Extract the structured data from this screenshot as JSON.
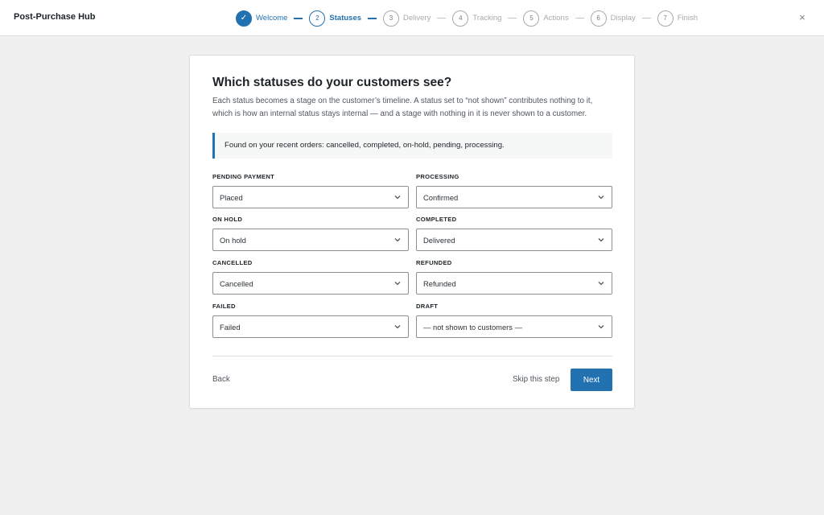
{
  "app": {
    "title": "Post-Purchase Hub"
  },
  "steps": [
    {
      "number": "✓",
      "label": "Welcome",
      "state": "done"
    },
    {
      "number": "2",
      "label": "Statuses",
      "state": "current"
    },
    {
      "number": "3",
      "label": "Delivery",
      "state": "todo"
    },
    {
      "number": "4",
      "label": "Tracking",
      "state": "todo"
    },
    {
      "number": "5",
      "label": "Actions",
      "state": "todo"
    },
    {
      "number": "6",
      "label": "Display",
      "state": "todo"
    },
    {
      "number": "7",
      "label": "Finish",
      "state": "todo"
    }
  ],
  "close_icon": "×",
  "card": {
    "title": "Which statuses do your customers see?",
    "description": "Each status becomes a stage on the customer’s timeline. A status set to “not shown” contributes nothing to it, which is how an internal status stays internal — and a stage with nothing in it is never shown to a customer.",
    "notice": "Found on your recent orders: cancelled, completed, on-hold, pending, processing.",
    "fields": [
      {
        "label": "PENDING PAYMENT",
        "value": "Placed"
      },
      {
        "label": "PROCESSING",
        "value": "Confirmed"
      },
      {
        "label": "ON HOLD",
        "value": "On hold"
      },
      {
        "label": "COMPLETED",
        "value": "Delivered"
      },
      {
        "label": "CANCELLED",
        "value": "Cancelled"
      },
      {
        "label": "REFUNDED",
        "value": "Refunded"
      },
      {
        "label": "FAILED",
        "value": "Failed"
      },
      {
        "label": "DRAFT",
        "value": "— not shown to customers —"
      }
    ],
    "back_label": "Back",
    "skip_label": "Skip this step",
    "next_label": "Next"
  },
  "colors": {
    "accent": "#2271b1",
    "background": "#f0f0f1"
  }
}
